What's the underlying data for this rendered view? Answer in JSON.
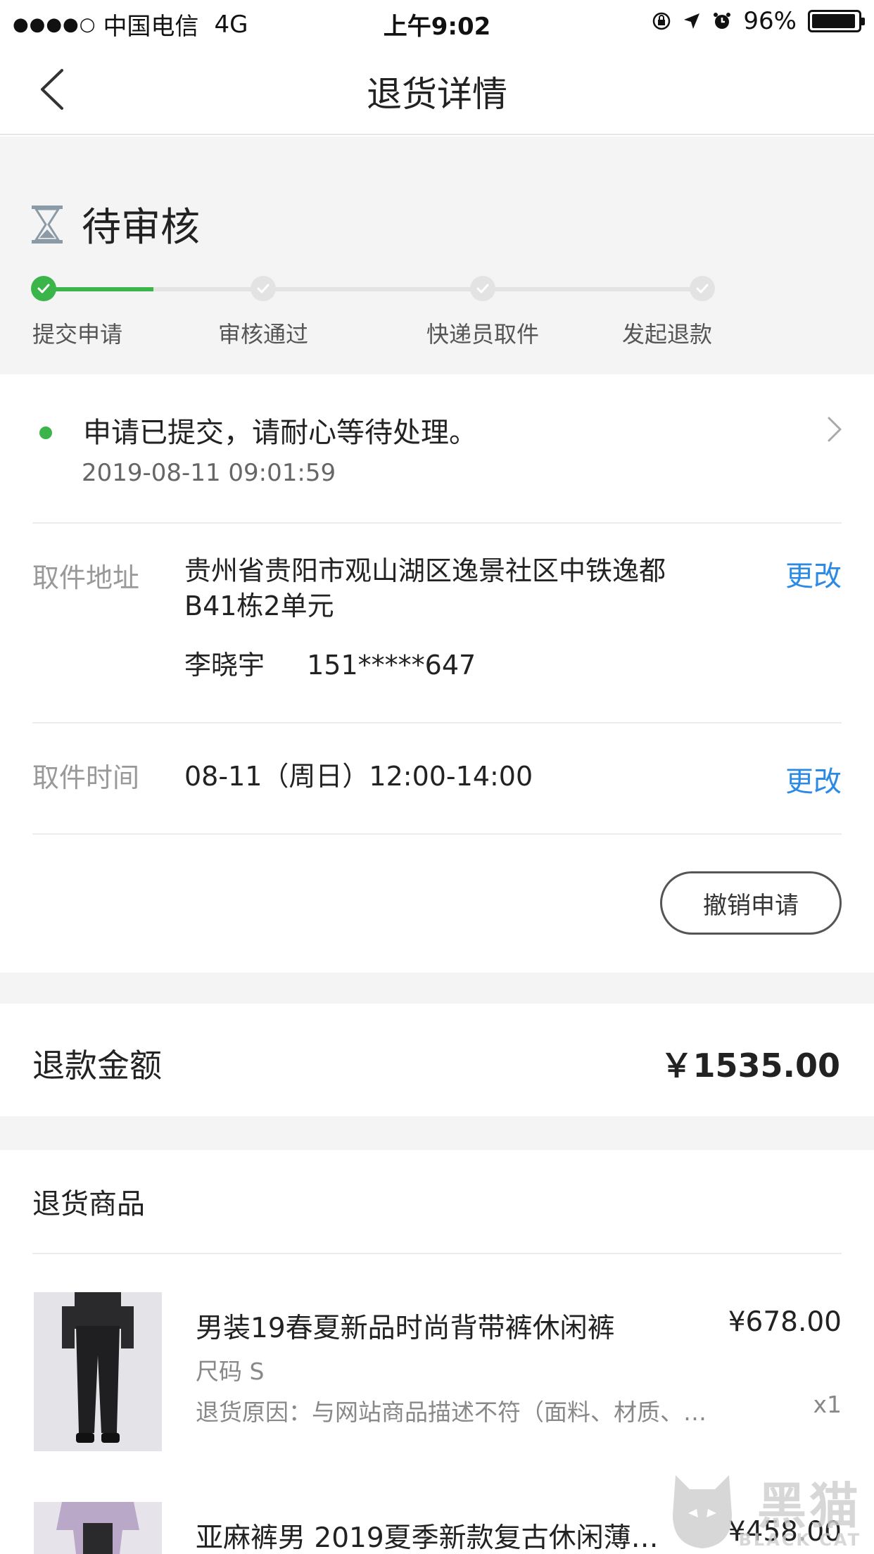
{
  "status_bar": {
    "carrier": "中国电信",
    "network": "4G",
    "time": "上午9:02",
    "battery": "96%",
    "battery_level": 0.96
  },
  "nav": {
    "title": "退货详情"
  },
  "review": {
    "status_label": "待审核",
    "steps": [
      {
        "label": "提交申请",
        "done": true
      },
      {
        "label": "审核通过",
        "done": false
      },
      {
        "label": "快递员取件",
        "done": false
      },
      {
        "label": "发起退款",
        "done": false
      }
    ]
  },
  "progress": {
    "message": "申请已提交，请耐心等待处理。",
    "timestamp": "2019-08-11 09:01:59"
  },
  "pickup_address": {
    "label": "取件地址",
    "line1": "贵州省贵阳市观山湖区逸景社区中铁逸都",
    "line2": "B41栋2单元",
    "contact_name": "李晓宇",
    "contact_phone": "151*****647",
    "change_label": "更改"
  },
  "pickup_time": {
    "label": "取件时间",
    "value": "08-11（周日）12:00-14:00",
    "change_label": "更改"
  },
  "cancel_label": "撤销申请",
  "refund": {
    "label": "退款金额",
    "amount": "￥1535.00"
  },
  "goods": {
    "heading": "退货商品",
    "items": [
      {
        "title": "男装19春夏新品时尚背带裤休闲裤",
        "price": "¥678.00",
        "size": "尺码  S",
        "reason": "退货原因：与网站商品描述不符（面料、材质、…",
        "qty": "x1"
      },
      {
        "title": "亚麻裤男 2019夏季新款复古休闲薄…",
        "price": "¥458.00"
      }
    ]
  },
  "watermark": {
    "cn": "黑猫",
    "en": "BLACK CAT"
  },
  "colors": {
    "accent_green": "#3bb54a",
    "link_blue": "#2b8ae6",
    "section_bg": "#f4f4f5"
  }
}
